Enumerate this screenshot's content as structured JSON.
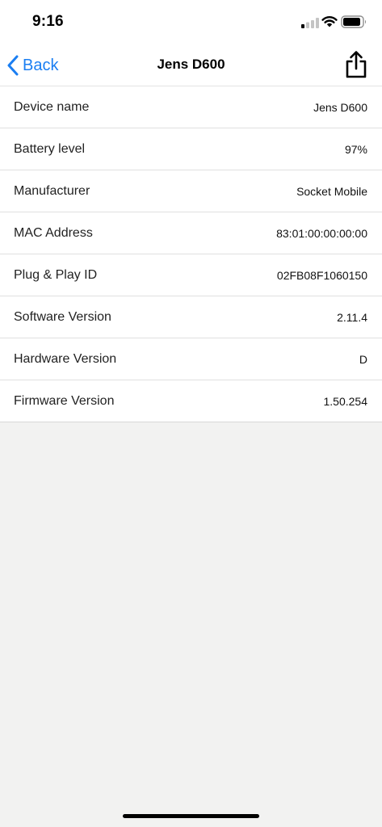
{
  "status_bar": {
    "time": "9:16",
    "signal_icon": "cellular-signal-icon",
    "wifi_icon": "wifi-icon",
    "battery_icon": "battery-icon"
  },
  "navbar": {
    "back_label": "Back",
    "back_icon": "chevron-left-icon",
    "title": "Jens D600",
    "share_icon": "share-icon"
  },
  "device_info": [
    {
      "label": "Device name",
      "value": "Jens D600"
    },
    {
      "label": "Battery level",
      "value": "97%"
    },
    {
      "label": "Manufacturer",
      "value": "Socket Mobile"
    },
    {
      "label": "MAC Address",
      "value": "83:01:00:00:00:00"
    },
    {
      "label": "Plug & Play ID",
      "value": "02FB08F1060150"
    },
    {
      "label": "Software Version",
      "value": "2.11.4"
    },
    {
      "label": "Hardware Version",
      "value": "D"
    },
    {
      "label": "Firmware Version",
      "value": "1.50.254"
    }
  ],
  "colors": {
    "accent": "#1a7ef2",
    "background": "#f2f2f1",
    "surface": "#ffffff"
  }
}
